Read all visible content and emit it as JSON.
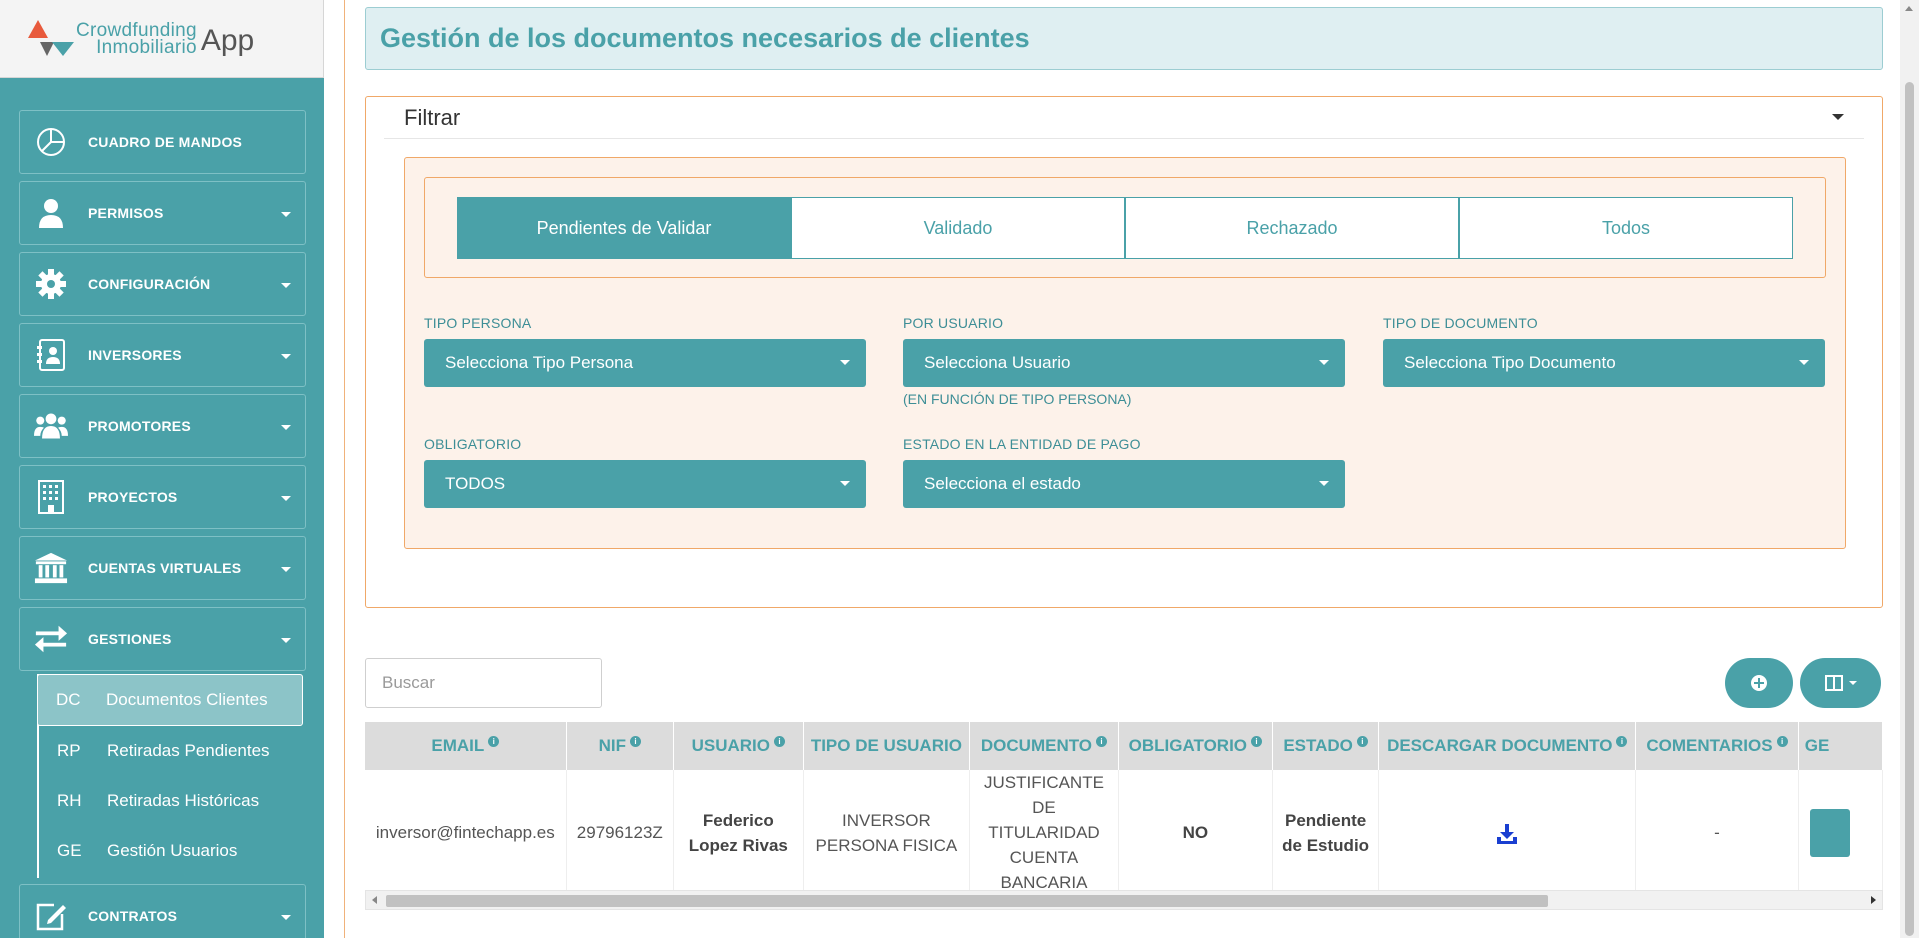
{
  "app": {
    "logo_line1": "Crowdfunding",
    "logo_line2": "Inmobiliario",
    "logo_app": "App",
    "logo_colors": [
      "#e85a3c",
      "#4aa1a8",
      "#666666"
    ]
  },
  "sidebar": {
    "items": [
      {
        "label": "CUADRO DE MANDOS",
        "icon": "pie-chart-icon",
        "has_caret": false
      },
      {
        "label": "PERMISOS",
        "icon": "user-icon",
        "has_caret": true
      },
      {
        "label": "CONFIGURACIÓN",
        "icon": "gear-icon",
        "has_caret": true
      },
      {
        "label": "INVERSORES",
        "icon": "contact-card-icon",
        "has_caret": true
      },
      {
        "label": "PROMOTORES",
        "icon": "users-group-icon",
        "has_caret": true
      },
      {
        "label": "PROYECTOS",
        "icon": "building-icon",
        "has_caret": true
      },
      {
        "label": "CUENTAS VIRTUALES",
        "icon": "bank-icon",
        "has_caret": true
      },
      {
        "label": "GESTIONES",
        "icon": "exchange-arrows-icon",
        "has_caret": true
      },
      {
        "label": "CONTRATOS",
        "icon": "edit-icon",
        "has_caret": true
      }
    ],
    "sub_items": [
      {
        "abbr": "DC",
        "label": "Documentos Clientes",
        "active": true
      },
      {
        "abbr": "RP",
        "label": "Retiradas Pendientes",
        "active": false
      },
      {
        "abbr": "RH",
        "label": "Retiradas Históricas",
        "active": false
      },
      {
        "abbr": "GE",
        "label": "Gestión Usuarios",
        "active": false
      }
    ]
  },
  "page": {
    "title": "Gestión de los documentos necesarios de clientes"
  },
  "filter": {
    "title": "Filtrar",
    "tabs": [
      {
        "label": "Pendientes de Validar",
        "active": true
      },
      {
        "label": "Validado",
        "active": false
      },
      {
        "label": "Rechazado",
        "active": false
      },
      {
        "label": "Todos",
        "active": false
      }
    ],
    "tipo_persona": {
      "label": "TIPO PERSONA",
      "value": "Selecciona Tipo Persona"
    },
    "por_usuario": {
      "label": "POR USUARIO",
      "value": "Selecciona Usuario",
      "hint": "(EN FUNCIÓN DE TIPO PERSONA)"
    },
    "tipo_documento": {
      "label": "TIPO DE DOCUMENTO",
      "value": "Selecciona Tipo Documento"
    },
    "obligatorio": {
      "label": "OBLIGATORIO",
      "value": "TODOS"
    },
    "estado": {
      "label": "ESTADO EN LA ENTIDAD DE PAGO",
      "value": "Selecciona el estado"
    }
  },
  "search": {
    "placeholder": "Buscar"
  },
  "table": {
    "columns": [
      "EMAIL",
      "NIF",
      "USUARIO",
      "TIPO DE USUARIO",
      "DOCUMENTO",
      "OBLIGATORIO",
      "ESTADO",
      "DESCARGAR DOCUMENTO",
      "COMENTARIOS",
      "GE"
    ],
    "rows": [
      {
        "email": "inversor@fintechapp.es",
        "nif": "29796123Z",
        "usuario": "Federico  Lopez Rivas",
        "tipo_usuario": "INVERSOR PERSONA FISICA",
        "documento": "JUSTIFICANTE DE TITULARIDAD CUENTA BANCARIA",
        "obligatorio": "NO",
        "estado": "Pendiente de Estudio",
        "descargar": "download-icon",
        "comentarios": "-"
      }
    ]
  },
  "colors": {
    "primary": "#4aa1a8",
    "accent_border": "#f0a868",
    "filter_bg": "#fdf2ea",
    "download_icon": "#1a3fd1"
  }
}
